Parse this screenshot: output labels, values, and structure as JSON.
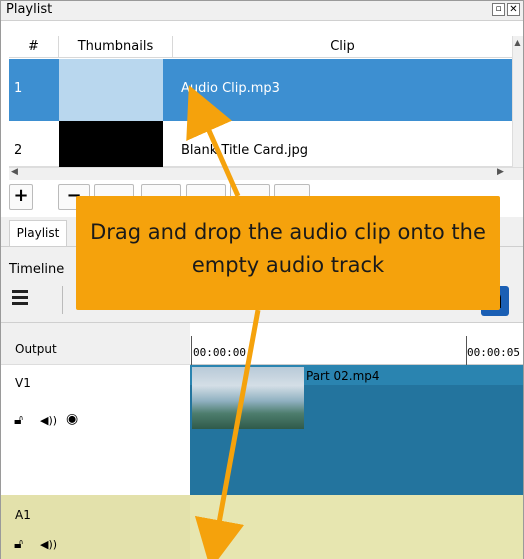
{
  "playlist": {
    "title": "Playlist",
    "columns": [
      "#",
      "Thumbnails",
      "Clip"
    ],
    "rows": [
      {
        "num": "1",
        "clip": "Audio Clip.mp3"
      },
      {
        "num": "2",
        "clip": "Blank Title Card.jpg"
      }
    ]
  },
  "toolbar": {
    "add_label": "+",
    "remove_label": "−"
  },
  "tabs": [
    {
      "label": "Playlist"
    }
  ],
  "timeline": {
    "title": "Timeline",
    "output_label": "Output",
    "ruler": [
      "00:00:00",
      "00:00:05"
    ],
    "tracks": [
      {
        "label": "V1",
        "clip": "Part 02.mp4"
      },
      {
        "label": "A1"
      }
    ]
  },
  "callout": {
    "text": "Drag and drop the audio clip onto the empty audio track"
  },
  "colors": {
    "selection": "#3d8fd1",
    "callout": "#f5a20c",
    "video_track": "#23749e",
    "audio_track": "#e7e6b0",
    "arrow": "#f5a20c"
  },
  "icons": {
    "float": "float-icon",
    "close": "close-icon",
    "menu": "menu-icon",
    "lock": "lock-icon",
    "mute": "speaker-icon",
    "visibility": "eye-icon",
    "snap": "snap-icon"
  }
}
